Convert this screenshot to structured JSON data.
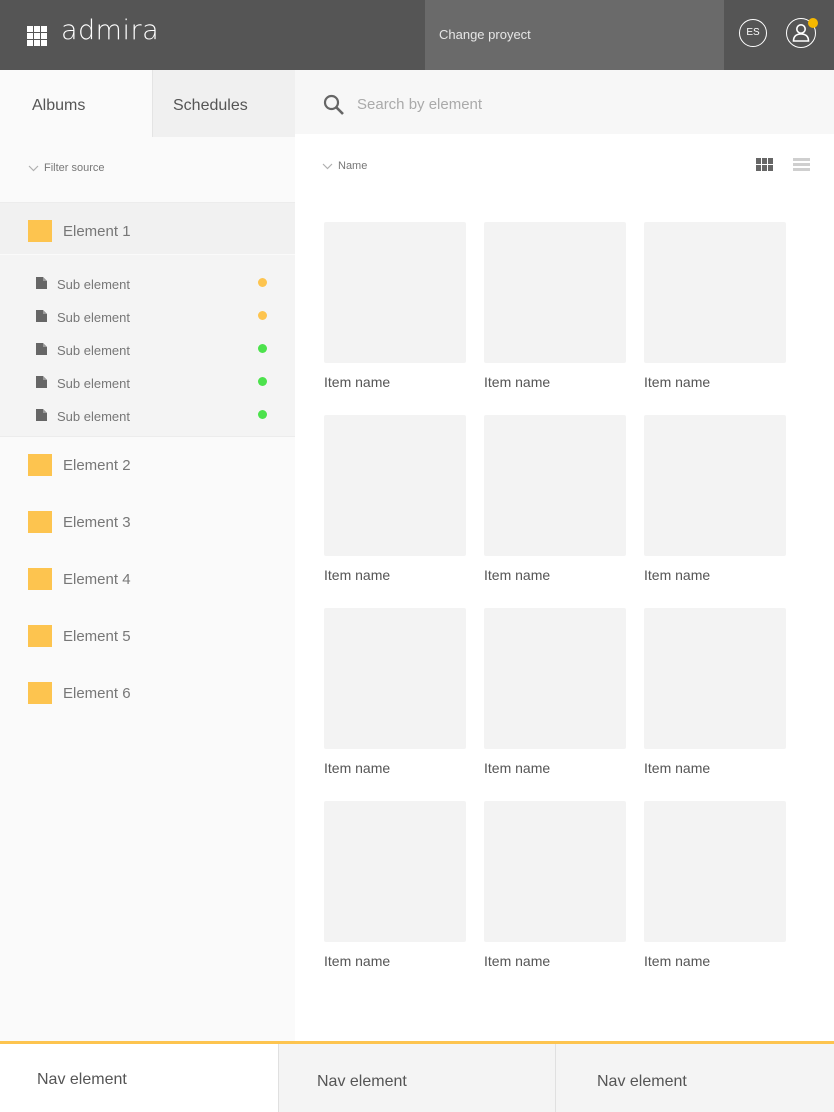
{
  "header": {
    "logo": "admira",
    "project_button": "Change proyect",
    "language": "ES"
  },
  "colors": {
    "accent": "#fdc44f",
    "notification": "#f5b800",
    "status_orange": "#fdc44f",
    "status_green": "#4ce24c",
    "header_bg": "#555555"
  },
  "sidebar": {
    "tabs": [
      {
        "label": "Albums",
        "active": true
      },
      {
        "label": "Schedules",
        "active": false
      }
    ],
    "filter_label": "Filter source",
    "elements": [
      {
        "label": "Element 1",
        "expanded": true
      },
      {
        "label": "Element 2"
      },
      {
        "label": "Element 3"
      },
      {
        "label": "Element 4"
      },
      {
        "label": "Element 5"
      },
      {
        "label": "Element 6"
      }
    ],
    "sub_elements": [
      {
        "label": "Sub element",
        "status": "orange"
      },
      {
        "label": "Sub element",
        "status": "orange"
      },
      {
        "label": "Sub element",
        "status": "green"
      },
      {
        "label": "Sub element",
        "status": "green"
      },
      {
        "label": "Sub element",
        "status": "green"
      }
    ]
  },
  "main": {
    "search_placeholder": "Search by element",
    "sort_label": "Name",
    "view_mode": "grid",
    "items": [
      "Item name",
      "Item name",
      "Item name",
      "Item name",
      "Item name",
      "Item name",
      "Item name",
      "Item name",
      "Item name",
      "Item name",
      "Item name",
      "Item name"
    ]
  },
  "bottom_nav": [
    "Nav element",
    "Nav element",
    "Nav element"
  ]
}
